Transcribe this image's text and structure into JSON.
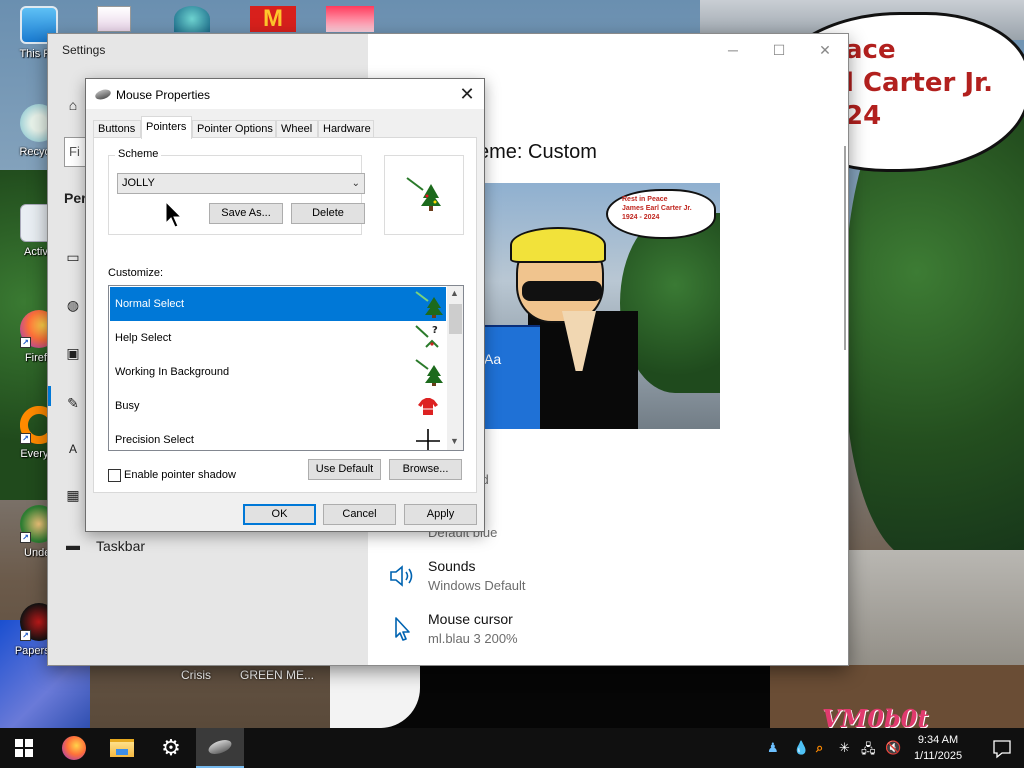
{
  "desktop": {
    "icons": [
      {
        "label": "This PC"
      },
      {
        "label": "Recycle"
      },
      {
        "label": "Activa"
      },
      {
        "label": "Firefo"
      },
      {
        "label": "Everyth"
      },
      {
        "label": "Under"
      },
      {
        "label": "Papers, P"
      }
    ],
    "bottom_labels": {
      "crisis": "Crisis",
      "green": "GREEN ME..."
    },
    "wallpaper_text": [
      "ace",
      "l Carter Jr.",
      "24"
    ],
    "watermark": "VM0b0t"
  },
  "settings": {
    "title": "Settings",
    "controls": {
      "minimize": "─",
      "maximize": "☐",
      "close": "✕"
    },
    "search_partial": "Fi",
    "section_partial": "Per",
    "nav_taskbar": "Taskbar",
    "theme_heading": "eme: Custom",
    "preview": {
      "aa": "Aa",
      "bubble_lines": [
        "Rest in Peace",
        "James Earl Carter Jr.",
        "1924 - 2024"
      ]
    },
    "options": [
      {
        "title": "und",
        "subtitle": "ackground"
      },
      {
        "title": "",
        "subtitle": "Default blue"
      },
      {
        "title": "Sounds",
        "subtitle": "Windows Default"
      },
      {
        "title": "Mouse cursor",
        "subtitle": "ml.blau 3 200%"
      }
    ]
  },
  "dialog": {
    "title": "Mouse Properties",
    "close": "✕",
    "tabs": [
      "Buttons",
      "Pointers",
      "Pointer Options",
      "Wheel",
      "Hardware"
    ],
    "active_tab": "Pointers",
    "scheme": {
      "label": "Scheme",
      "value": "JOLLY",
      "save_as": "Save As...",
      "delete": "Delete"
    },
    "customize_label": "Customize:",
    "cursors": [
      {
        "name": "Normal Select",
        "icon": "pine-tree-arrow-icon"
      },
      {
        "name": "Help Select",
        "icon": "help-pointer-icon"
      },
      {
        "name": "Working In Background",
        "icon": "pine-tree-arrow-icon"
      },
      {
        "name": "Busy",
        "icon": "sweater-icon"
      },
      {
        "name": "Precision Select",
        "icon": "crosshair-icon"
      }
    ],
    "shadow_label": "Enable pointer shadow",
    "use_default": "Use Default",
    "browse": "Browse...",
    "ok": "OK",
    "cancel": "Cancel",
    "apply": "Apply"
  },
  "taskbar": {
    "time": "9:34 AM",
    "date": "1/11/2025"
  },
  "colors": {
    "accent": "#0078d7",
    "taskbar": "#101010"
  }
}
